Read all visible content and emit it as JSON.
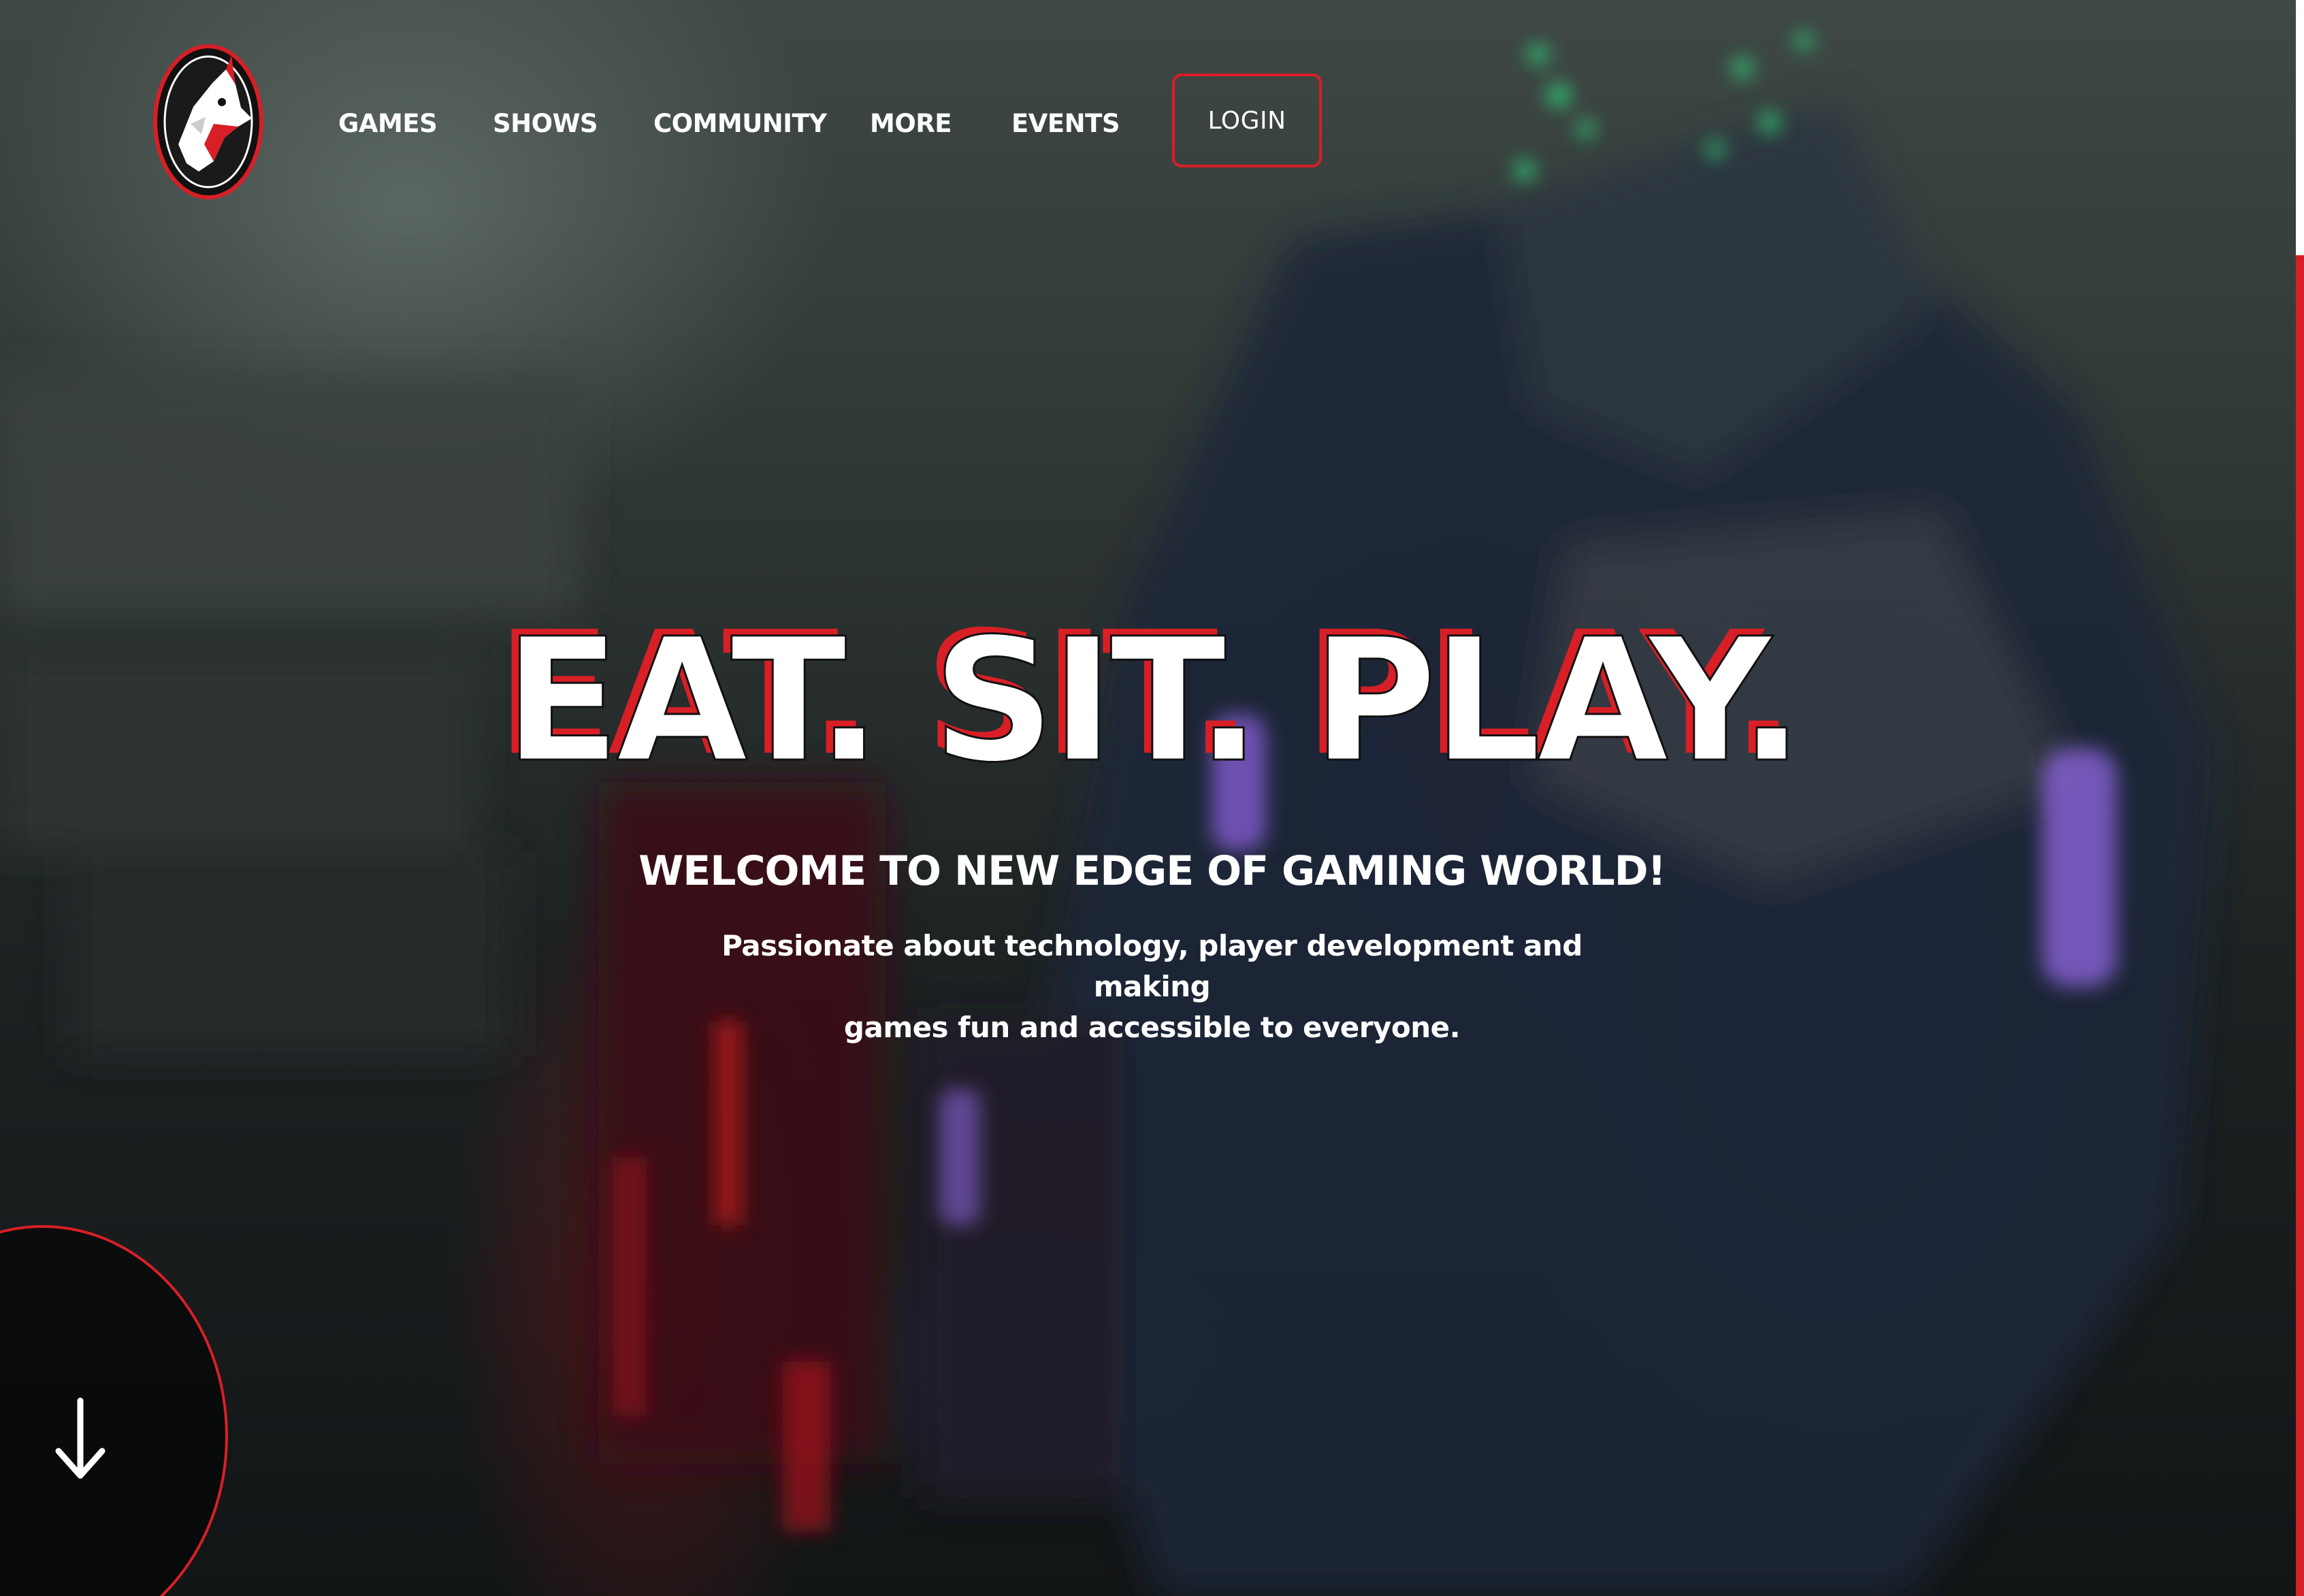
{
  "nav": {
    "items": [
      {
        "label": "GAMES"
      },
      {
        "label": "SHOWS"
      },
      {
        "label": "COMMUNITY"
      },
      {
        "label": "MORE"
      },
      {
        "label": "EVENTS"
      }
    ],
    "login_label": "LOGIN"
  },
  "logo": {
    "icon": "wolf-logo-icon"
  },
  "hero": {
    "headline": "EAT. SIT. PLAY.",
    "subheadline": "WELCOME TO NEW EDGE OF GAMING WORLD!",
    "tagline_line1": "Passionate about technology, player development and making",
    "tagline_line2": "games fun and accessible to everyone."
  },
  "scroll": {
    "icon": "arrow-down-icon"
  },
  "colors": {
    "accent": "#d81f26",
    "text": "#ffffff",
    "background": "#1d2223"
  }
}
